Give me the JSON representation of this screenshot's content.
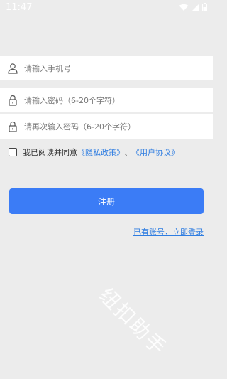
{
  "status_bar": {
    "time": "11:47"
  },
  "form": {
    "phone_placeholder": "请输入手机号",
    "password_placeholder": "请输入密码（6-20个字符）",
    "confirm_placeholder": "请再次输入密码（6-20个字符）"
  },
  "agreement": {
    "prefix": "我已阅读并同意",
    "privacy_link": "《隐私政策》",
    "separator": "、",
    "terms_link": "《用户协议》"
  },
  "actions": {
    "register_label": "注册",
    "login_link": "已有账号，立即登录"
  },
  "watermark": "纽扣助手",
  "colors": {
    "accent": "#3b7cf6",
    "link": "#2f7de1",
    "background": "#ececec"
  }
}
